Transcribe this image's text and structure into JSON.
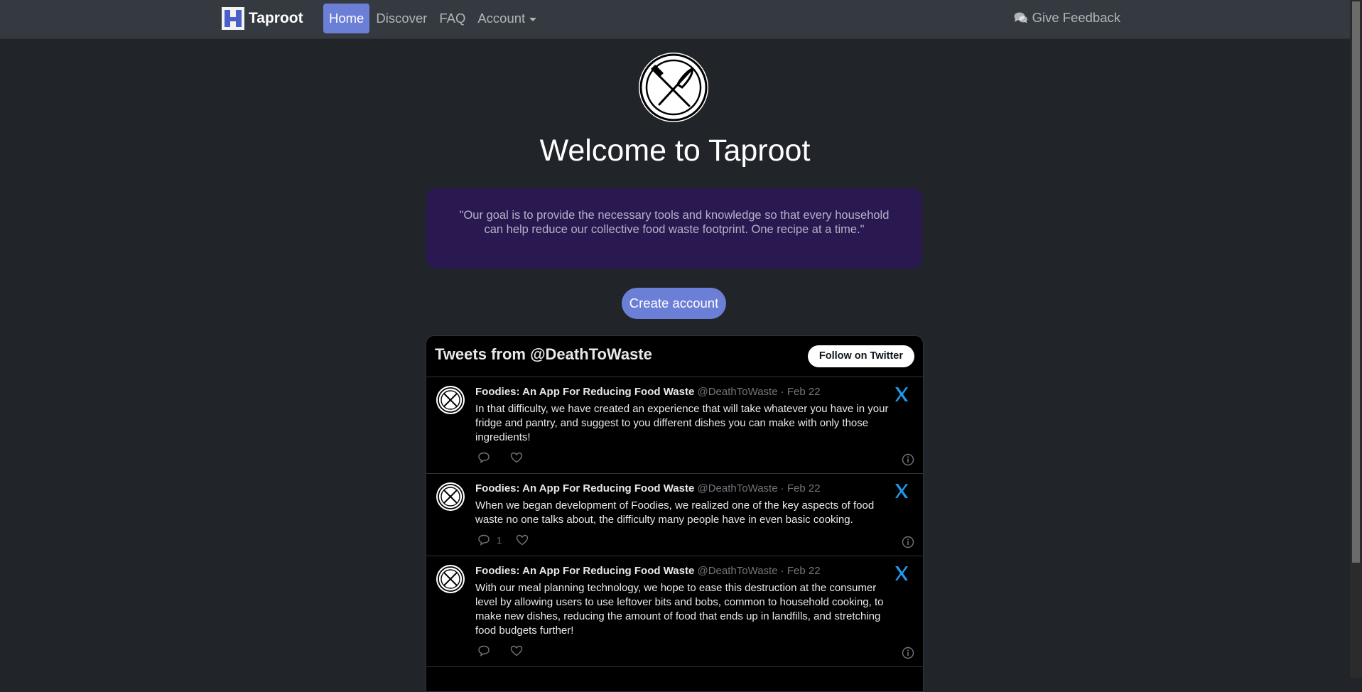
{
  "nav": {
    "brand": "Taproot",
    "links": [
      {
        "label": "Home"
      },
      {
        "label": "Discover"
      },
      {
        "label": "FAQ"
      },
      {
        "label": "Account"
      }
    ],
    "feedback_label": "Give Feedback",
    "feedback_icon": "comments-icon"
  },
  "hero": {
    "title": "Welcome to Taproot",
    "quote": "\"Our goal is to provide the necessary tools and knowledge so that every household can help reduce our collective food waste footprint. One recipe at a time.\"",
    "cta_label": "Create account"
  },
  "colors": {
    "accent": "#6b7fd7",
    "quote_bg": "#2a1850",
    "page_bg": "#212529",
    "navbar_bg": "#343a40",
    "x_blue": "#1d9bf0"
  },
  "timeline": {
    "title": "Tweets from @DeathToWaste",
    "follow_label": "Follow on Twitter",
    "tweets": [
      {
        "name": "Foodies: An App For Reducing Food Waste",
        "handle": "@DeathToWaste",
        "date": "· Feb 22",
        "text": "In that difficulty, we have created an experience that will take whatever you have in your fridge and pantry, and suggest to you different dishes you can make with only those ingredients!",
        "replies": "",
        "likes": ""
      },
      {
        "name": "Foodies: An App For Reducing Food Waste",
        "handle": "@DeathToWaste",
        "date": "· Feb 22",
        "text": "When we began development of Foodies, we realized one of the key aspects of food waste no one talks about, the difficulty many people have in even basic cooking.",
        "replies": "1",
        "likes": ""
      },
      {
        "name": "Foodies: An App For Reducing Food Waste",
        "handle": "@DeathToWaste",
        "date": "· Feb 22",
        "text": "With our meal planning technology, we hope to ease this destruction at the consumer level by allowing users to use leftover bits and bobs, common to household cooking, to make new dishes, reducing the amount of food that ends up in landfills, and stretching food budgets further!",
        "replies": "",
        "likes": ""
      }
    ]
  }
}
